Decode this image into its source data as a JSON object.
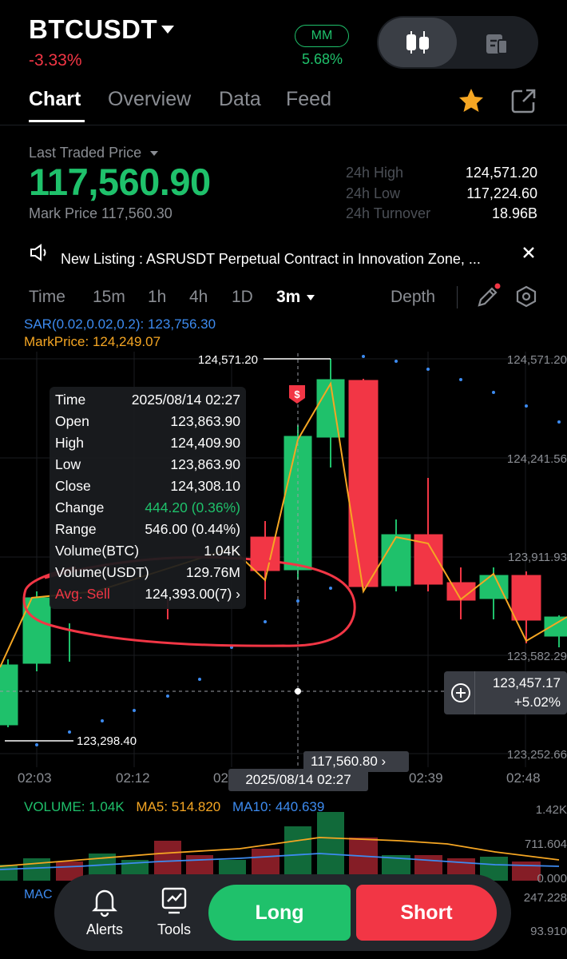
{
  "header": {
    "symbol": "BTCUSDT",
    "change": "-3.33%",
    "mm_label": "MM",
    "mm_value": "5.68%"
  },
  "tabs": [
    "Chart",
    "Overview",
    "Data",
    "Feed"
  ],
  "price_panel": {
    "label": "Last Traded Price",
    "last_price": "117,560.90",
    "mark_price": "Mark Price 117,560.30",
    "stats": [
      {
        "label": "24h High",
        "value": "124,571.20"
      },
      {
        "label": "24h Low",
        "value": "117,224.60"
      },
      {
        "label": "24h Turnover",
        "value": "18.96B"
      }
    ]
  },
  "announcement": {
    "text": "New Listing : ASRUSDT Perpetual Contract in Innovation Zone, ..."
  },
  "timeframes": {
    "items": [
      "Time",
      "15m",
      "1h",
      "4h",
      "1D"
    ],
    "selected": "3m",
    "depth": "Depth"
  },
  "indicators": {
    "sar": "SAR(0.02,0.02,0.2): 123,756.30",
    "markprice": "MarkPrice: 124,249.07"
  },
  "tooltip": {
    "rows": [
      {
        "label": "Time",
        "value": "2025/08/14 02:27"
      },
      {
        "label": "Open",
        "value": "123,863.90"
      },
      {
        "label": "High",
        "value": "124,409.90"
      },
      {
        "label": "Low",
        "value": "123,863.90"
      },
      {
        "label": "Close",
        "value": "124,308.10"
      },
      {
        "label": "Change",
        "value": "444.20 (0.36%)"
      },
      {
        "label": "Range",
        "value": "546.00 (0.44%)"
      },
      {
        "label": "Volume(BTC)",
        "value": "1.04K"
      },
      {
        "label": "Volume(USDT)",
        "value": "129.76M"
      },
      {
        "label": "Avg. Sell",
        "value": "124,393.00(7) ›"
      }
    ]
  },
  "chart_data": {
    "type": "candlestick",
    "y_axis_labels": [
      "124,571.20",
      "124,241.56",
      "123,911.93",
      "123,582.29",
      "123,252.66"
    ],
    "x_axis_labels": [
      "02:03",
      "02:12",
      "02:",
      "02:39",
      "02:48"
    ],
    "high_marker": "124,571.20",
    "low_marker": "123,298.40",
    "crosshair_price": "123,457.17",
    "crosshair_change": "+5.02%",
    "last_price_tag": "117,560.80 ›",
    "crosshair_time": "2025/08/14 02:27",
    "colors": {
      "up": "#1fc16b",
      "down": "#f23645",
      "sar": "#3d8bf0",
      "markprice": "#f5a623"
    }
  },
  "volume": {
    "label": "VOLUME: 1.04K",
    "ma5": "MA5: 514.820",
    "ma10": "MA10: 440.639",
    "axis": [
      "1.42K",
      "711.604",
      "0.000"
    ]
  },
  "macd": {
    "label": "MAC",
    "axis": [
      "247.228",
      "93.910"
    ]
  },
  "bottom_bar": {
    "alerts": "Alerts",
    "tools": "Tools",
    "long": "Long",
    "short": "Short"
  }
}
